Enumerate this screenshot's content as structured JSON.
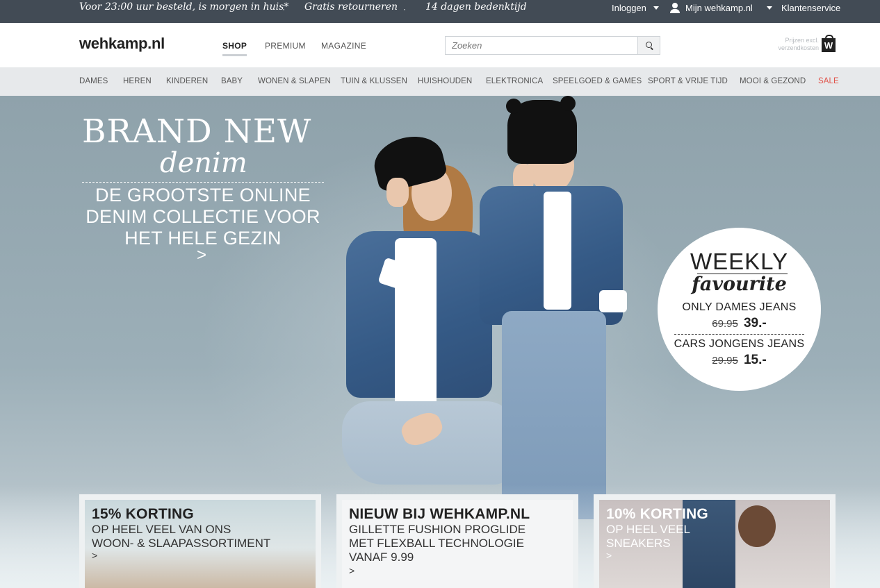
{
  "topbar": {
    "promo_1": "Voor 23:00 uur besteld, is morgen in huis*",
    "promo_2": "Gratis retourneren",
    "promo_3": "14 dagen bedenktijd",
    "separator": "·",
    "login": "Inloggen",
    "account": "Mijn wehkamp.nl",
    "service": "Klantenservice"
  },
  "header": {
    "logo": "wehkamp.nl",
    "nav": [
      "SHOP",
      "PREMIUM",
      "MAGAZINE"
    ],
    "search_placeholder": "Zoeken",
    "price_note": "Prijzen excl. verzendkosten",
    "bag_letter": "W"
  },
  "categories": [
    "DAMES",
    "HEREN",
    "KINDEREN",
    "BABY",
    "WONEN & SLAPEN",
    "TUIN & KLUSSEN",
    "HUISHOUDEN",
    "ELEKTRONICA",
    "SPEELGOED & GAMES",
    "SPORT & VRIJE TIJD",
    "MOOI & GEZOND",
    "SALE"
  ],
  "hero": {
    "title": "BRAND NEW",
    "script": "denim",
    "subtitle": "DE GROOTSTE ONLINE DENIM COLLECTIE VOOR HET HELE GEZIN",
    "arrow": ">"
  },
  "weekly": {
    "title": "WEEKLY",
    "script": "favourite",
    "item1_name": "ONLY DAMES JEANS",
    "item1_old": "69.95",
    "item1_new": "39.-",
    "item2_name": "CARS JONGENS JEANS",
    "item2_old": "29.95",
    "item2_new": "15.-"
  },
  "cards": [
    {
      "title": "15% KORTING",
      "line1": "OP HEEL VEEL VAN ONS",
      "line2": "WOON- & SLAAPASSORTIMENT",
      "arrow": ">"
    },
    {
      "title": "NIEUW BIJ WEHKAMP.NL",
      "line1": "GILLETTE FUSHION PROGLIDE",
      "line2": "MET FLEXBALL TECHNOLOGIE",
      "line3": "VANAF 9.99",
      "arrow": ">"
    },
    {
      "title": "10% KORTING",
      "line1": "OP HEEL VEEL",
      "line2": "SNEAKERS",
      "arrow": ">"
    }
  ],
  "colors": {
    "topbar": "#424b55",
    "catbar": "#e7e9eb",
    "sale": "#e0534a",
    "hero": "#9cafb8"
  },
  "icons": [
    "chevron-down-icon",
    "user-icon",
    "search-icon",
    "shopping-bag-icon"
  ]
}
